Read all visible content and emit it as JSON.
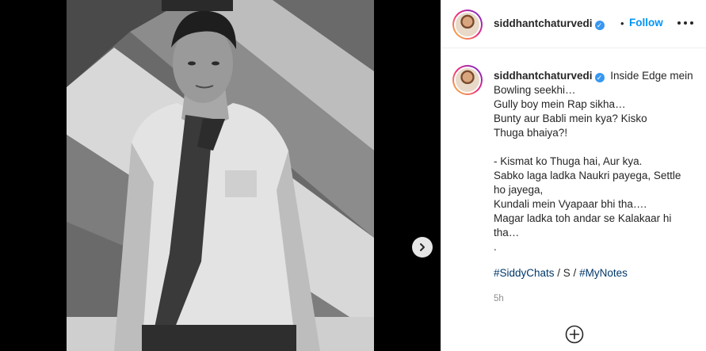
{
  "post": {
    "username": "siddhantchaturvedi",
    "follow_label": "Follow",
    "dot_separator": "•",
    "caption_lines": [
      "Inside Edge mein",
      "Bowling seekhi…",
      "Gully boy mein Rap sikha…",
      "Bunty aur Babli mein kya? Kisko",
      "Thuga bhaiya?!",
      "",
      "- Kismat ko Thuga hai, Aur kya.",
      "Sabko laga ladka Naukri payega, Settle",
      "ho jayega,",
      "Kundali mein Vyapaar bhi tha….",
      "Magar ladka toh andar se Kalakaar hi",
      "tha…",
      "."
    ],
    "hashtags": {
      "tag1": "#SiddyChats",
      "separator": " / S / ",
      "tag2": "#MyNotes"
    },
    "time_ago": "5h"
  },
  "icons": {
    "verified": "verified-badge-icon",
    "more": "more-options-icon",
    "next": "chevron-right-icon",
    "add": "plus-circle-icon"
  },
  "colors": {
    "link_blue": "#0095f6",
    "hashtag_blue": "#00376b",
    "verified_blue": "#3897f0",
    "muted_gray": "#8e8e8e",
    "text": "#262626"
  }
}
